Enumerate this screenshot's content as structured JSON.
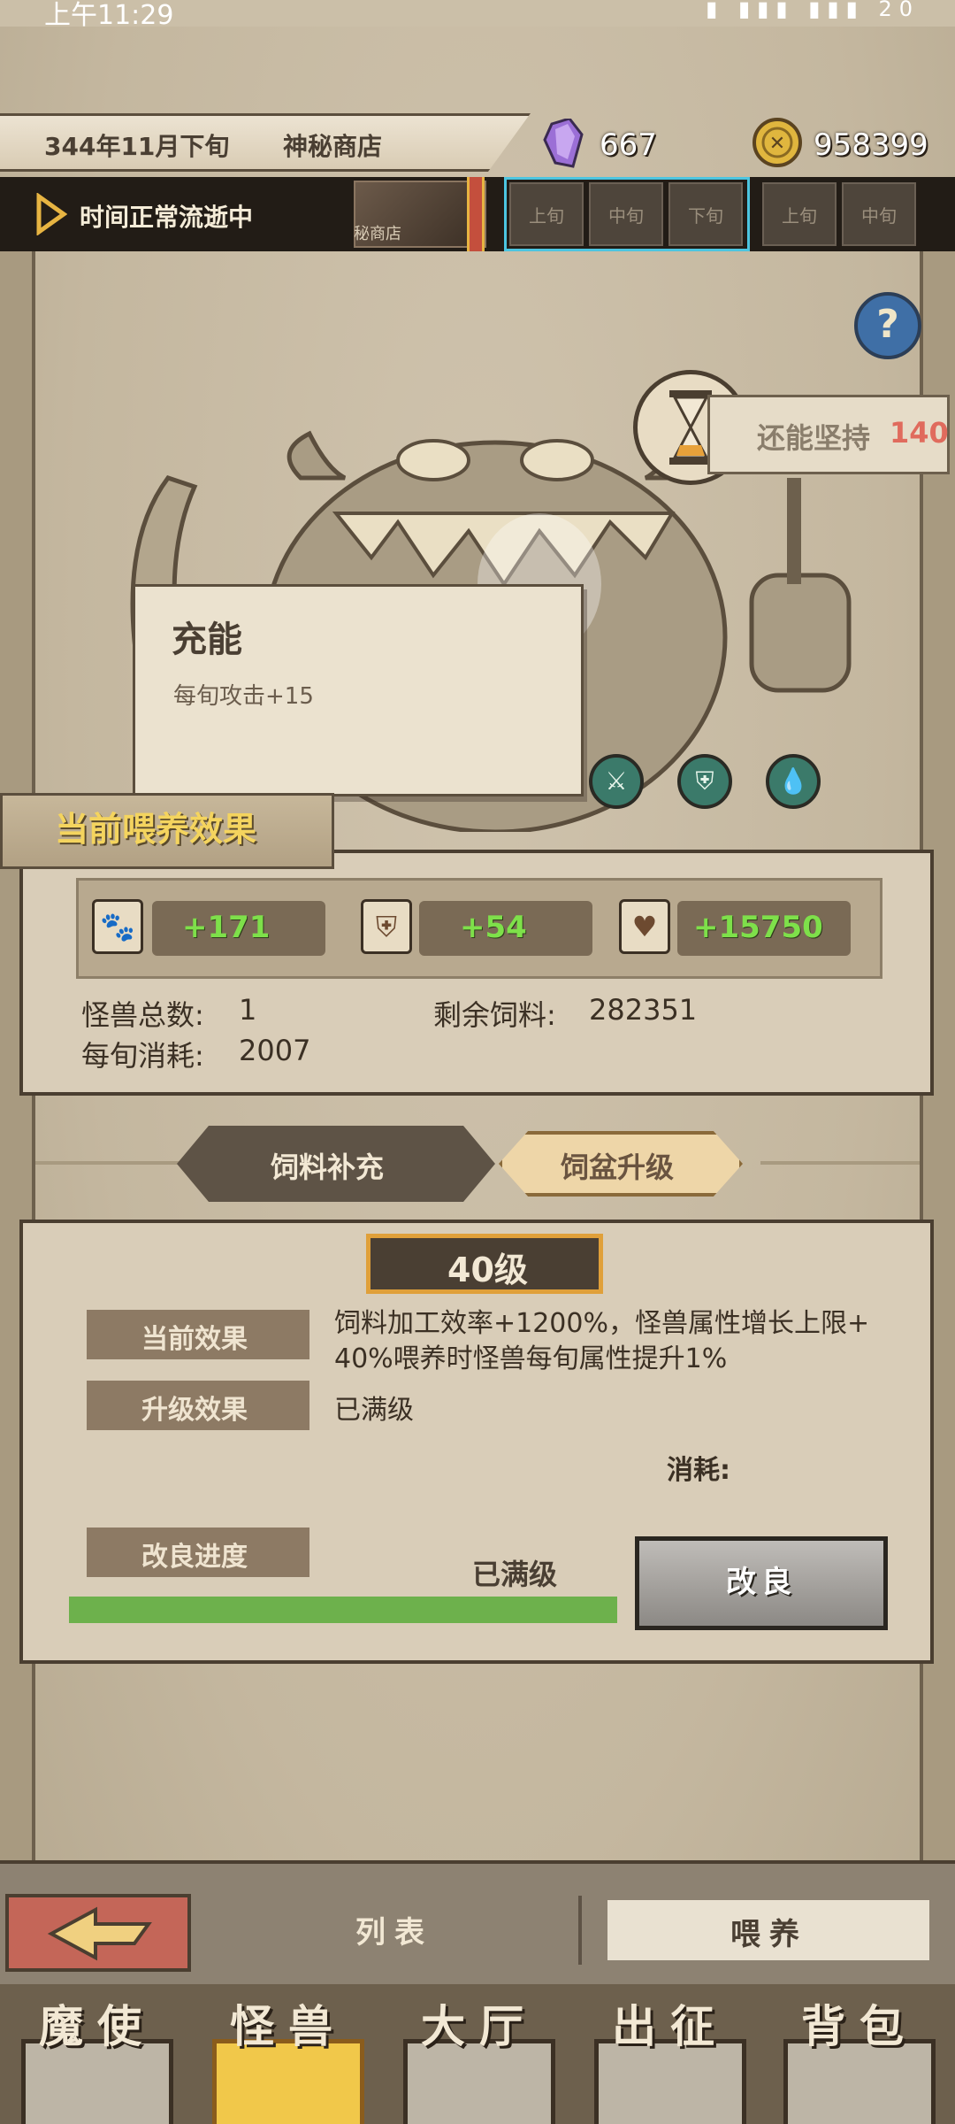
{
  "status_bar": {
    "time": "上午11:29",
    "icons": "▮ ▮▮▮ ▮▮▮ 20"
  },
  "header": {
    "date": "344年11月下旬",
    "location": "神秘商店",
    "crystals": "667",
    "coins": "958399"
  },
  "time_bar": {
    "status": "时间正常流逝中",
    "shop_thumb_label": "秘商店",
    "slots": [
      "上旬",
      "中旬",
      "下旬",
      "上旬",
      "中旬"
    ]
  },
  "stage": {
    "help_icon": "?",
    "persist_label": "还能坚持",
    "persist_value": "140"
  },
  "tooltip": {
    "title": "充能",
    "description": "每旬攻击+15"
  },
  "feeding_effect": {
    "title": "当前喂养效果",
    "stats": [
      {
        "icon": "paw-icon",
        "value": "+171"
      },
      {
        "icon": "shield-icon",
        "value": "+54"
      },
      {
        "icon": "heart-icon",
        "value": "+15750"
      }
    ],
    "monster_count_label": "怪兽总数:",
    "monster_count": "1",
    "remaining_feed_label": "剩余饲料:",
    "remaining_feed": "282351",
    "consumption_label": "每旬消耗:",
    "consumption": "2007"
  },
  "tabs": {
    "feed_supply": "饲料补充",
    "bowl_upgrade": "饲盆升级"
  },
  "upgrade": {
    "level": "40级",
    "current_effect_label": "当前效果",
    "current_effect_line1": "饲料加工效率+1200%，怪兽属性增长上限+",
    "current_effect_line2": "40%喂养时怪兽每旬属性提升1%",
    "upgrade_effect_label": "升级效果",
    "upgrade_effect": "已满级",
    "cost_label": "消耗:",
    "progress_label": "改良进度",
    "progress_status": "已满级",
    "progress_fraction": 1.0,
    "improve_button": "改良"
  },
  "bottom_bar": {
    "back_icon": "back-arrow-icon",
    "list_label": "列表",
    "feed_label": "喂养"
  },
  "nav": {
    "items": [
      {
        "label": "魔使",
        "active": false
      },
      {
        "label": "怪兽",
        "active": true
      },
      {
        "label": "大厅",
        "active": false
      },
      {
        "label": "出征",
        "active": false
      },
      {
        "label": "背包",
        "active": false
      }
    ]
  },
  "colors": {
    "accent_gold": "#f4d45e",
    "stat_green": "#7ee04a",
    "persist_red": "#e06b5d",
    "progress_green": "#6db14c",
    "active_slot_border": "#4cc5e0"
  }
}
